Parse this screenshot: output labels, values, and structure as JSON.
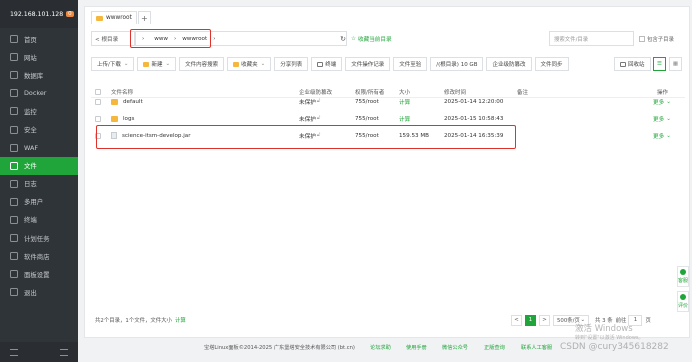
{
  "sidebar": {
    "host_ip": "192.168.101.128",
    "badge": "0",
    "items": [
      {
        "label": "首页",
        "icon": "home-icon"
      },
      {
        "label": "网站",
        "icon": "globe-icon"
      },
      {
        "label": "数据库",
        "icon": "database-icon"
      },
      {
        "label": "Docker",
        "icon": "docker-icon"
      },
      {
        "label": "监控",
        "icon": "monitor-icon"
      },
      {
        "label": "安全",
        "icon": "shield-icon"
      },
      {
        "label": "WAF",
        "icon": "waf-icon"
      },
      {
        "label": "文件",
        "icon": "folder-icon",
        "active": true
      },
      {
        "label": "日志",
        "icon": "log-icon"
      },
      {
        "label": "多用户",
        "icon": "users-icon"
      },
      {
        "label": "终端",
        "icon": "terminal-icon"
      },
      {
        "label": "计划任务",
        "icon": "clock-icon"
      },
      {
        "label": "软件商店",
        "icon": "store-icon"
      },
      {
        "label": "面板设置",
        "icon": "gear-icon"
      },
      {
        "label": "退出",
        "icon": "logout-icon"
      }
    ]
  },
  "tabs": {
    "active": "wwwroot",
    "add": "+"
  },
  "path": {
    "back_label": "< 根目录",
    "crumbs": [
      "www",
      "wwwroot"
    ],
    "favorite_label": "收藏当前目录",
    "search_placeholder": "搜索文件/目录",
    "subdir_label": "包含子目录"
  },
  "toolbar": {
    "upload": "上传/下载",
    "new": "新建",
    "content_search": "文件内容搜索",
    "favorites": "收藏夹",
    "share_list": "分享列表",
    "terminal": "终端",
    "op_log": "文件操作记录",
    "file_verify": "文件至验",
    "disk": "/(根目录) 10 GB",
    "enterprise_protect": "企业级防篡改",
    "file_sync": "文件同步",
    "recycle": "回收站"
  },
  "table": {
    "headers": {
      "name": "文件名称",
      "protect": "企业级防篡改",
      "perm": "权限/所有者",
      "size": "大小",
      "modified": "修改时间",
      "note": "备注",
      "ops": "操作"
    },
    "rows": [
      {
        "name": "default",
        "type": "folder",
        "protect": "未保护",
        "perm": "755/root",
        "size": "计算",
        "modified": "2025-01-14 12:20:00",
        "ops": "更多"
      },
      {
        "name": "logs",
        "type": "folder",
        "protect": "未保护",
        "perm": "755/root",
        "size": "计算",
        "modified": "2025-01-15 10:58:43",
        "ops": "更多"
      },
      {
        "name": "science-itsm-develop.jar",
        "type": "file",
        "protect": "未保护",
        "perm": "755/root",
        "size": "159.53 MB",
        "modified": "2025-01-14 16:35:39",
        "ops": "更多"
      }
    ]
  },
  "footer": {
    "summary": "共2个目录，1个文件，文件大小",
    "calc": "计算",
    "prev": "<",
    "page": "1",
    "next": ">",
    "page_size": "500条/页",
    "total": "共 3 条",
    "goto": "前往",
    "page_input": "1",
    "page_unit": "页"
  },
  "bottom": {
    "copyright": "宝塔Linux面板©2014-2025 广东堡塔安全技术有限公司 (bt.cn)",
    "forum": "论坛求助",
    "manual": "使用手册",
    "wechat": "微信公众号",
    "certify": "正版查询",
    "support": "联系人工客服"
  },
  "side_right": [
    "客服",
    "评价"
  ],
  "watermark": {
    "line1": "激活 Windows",
    "line2": "转到\"设置\"以激活 Windows。",
    "csdn": "CSDN @cury345618282"
  },
  "colors": {
    "sidebar_bg": "#2f3438",
    "accent": "#20a53a",
    "highlight": "#e0322c",
    "folder": "#f5b83d"
  }
}
